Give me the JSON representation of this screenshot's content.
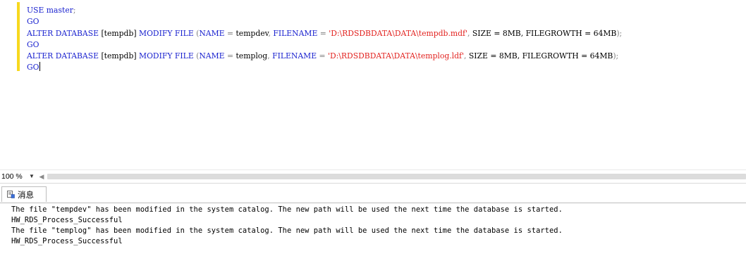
{
  "editor": {
    "lines": [
      [
        {
          "t": "USE master",
          "c": "kw"
        },
        {
          "t": ";",
          "c": "op"
        }
      ],
      [
        {
          "t": "GO",
          "c": "kw"
        }
      ],
      [
        {
          "t": "ALTER DATABASE ",
          "c": "kw"
        },
        {
          "t": "[tempdb] ",
          "c": "plain"
        },
        {
          "t": "MODIFY FILE ",
          "c": "kw"
        },
        {
          "t": "(",
          "c": "op"
        },
        {
          "t": "NAME",
          "c": "kw"
        },
        {
          "t": " = ",
          "c": "op"
        },
        {
          "t": "tempdev",
          "c": "plain"
        },
        {
          "t": ", ",
          "c": "op"
        },
        {
          "t": "FILENAME",
          "c": "kw"
        },
        {
          "t": " = ",
          "c": "op"
        },
        {
          "t": "'D:\\RDSDBDATA\\DATA\\tempdb.mdf'",
          "c": "str"
        },
        {
          "t": ", ",
          "c": "op"
        },
        {
          "t": "SIZE = 8MB, FILEGROWTH = 64MB",
          "c": "plain"
        },
        {
          "t": ");",
          "c": "op"
        }
      ],
      [
        {
          "t": "GO",
          "c": "kw"
        }
      ],
      [
        {
          "t": "ALTER DATABASE ",
          "c": "kw"
        },
        {
          "t": "[tempdb] ",
          "c": "plain"
        },
        {
          "t": "MODIFY FILE ",
          "c": "kw"
        },
        {
          "t": "(",
          "c": "op"
        },
        {
          "t": "NAME",
          "c": "kw"
        },
        {
          "t": " = ",
          "c": "op"
        },
        {
          "t": "templog",
          "c": "plain"
        },
        {
          "t": ", ",
          "c": "op"
        },
        {
          "t": "FILENAME",
          "c": "kw"
        },
        {
          "t": " = ",
          "c": "op"
        },
        {
          "t": "'D:\\RDSDBDATA\\DATA\\templog.ldf'",
          "c": "str"
        },
        {
          "t": ", ",
          "c": "op"
        },
        {
          "t": "SIZE = 8MB, FILEGROWTH = 64MB",
          "c": "plain"
        },
        {
          "t": ");",
          "c": "op"
        }
      ],
      [
        {
          "t": "GO",
          "c": "kw"
        }
      ]
    ],
    "changebar_color": "#f7d81f",
    "keyword_color": "#1a22cf",
    "string_color": "#e2211e",
    "operator_color": "#7f7f7f"
  },
  "statusbar": {
    "zoom": "100 %",
    "zoom_dropdown_icon": "chevron-down-icon",
    "scroll_left_icon": "chevron-left-icon"
  },
  "results": {
    "tab_label": "消息",
    "tab_icon": "messages-icon",
    "messages": [
      "The file \"tempdev\" has been modified in the system catalog. The new path will be used the next time the database is started.",
      "HW_RDS_Process_Successful",
      "The file \"templog\" has been modified in the system catalog. The new path will be used the next time the database is started.",
      "HW_RDS_Process_Successful"
    ]
  }
}
